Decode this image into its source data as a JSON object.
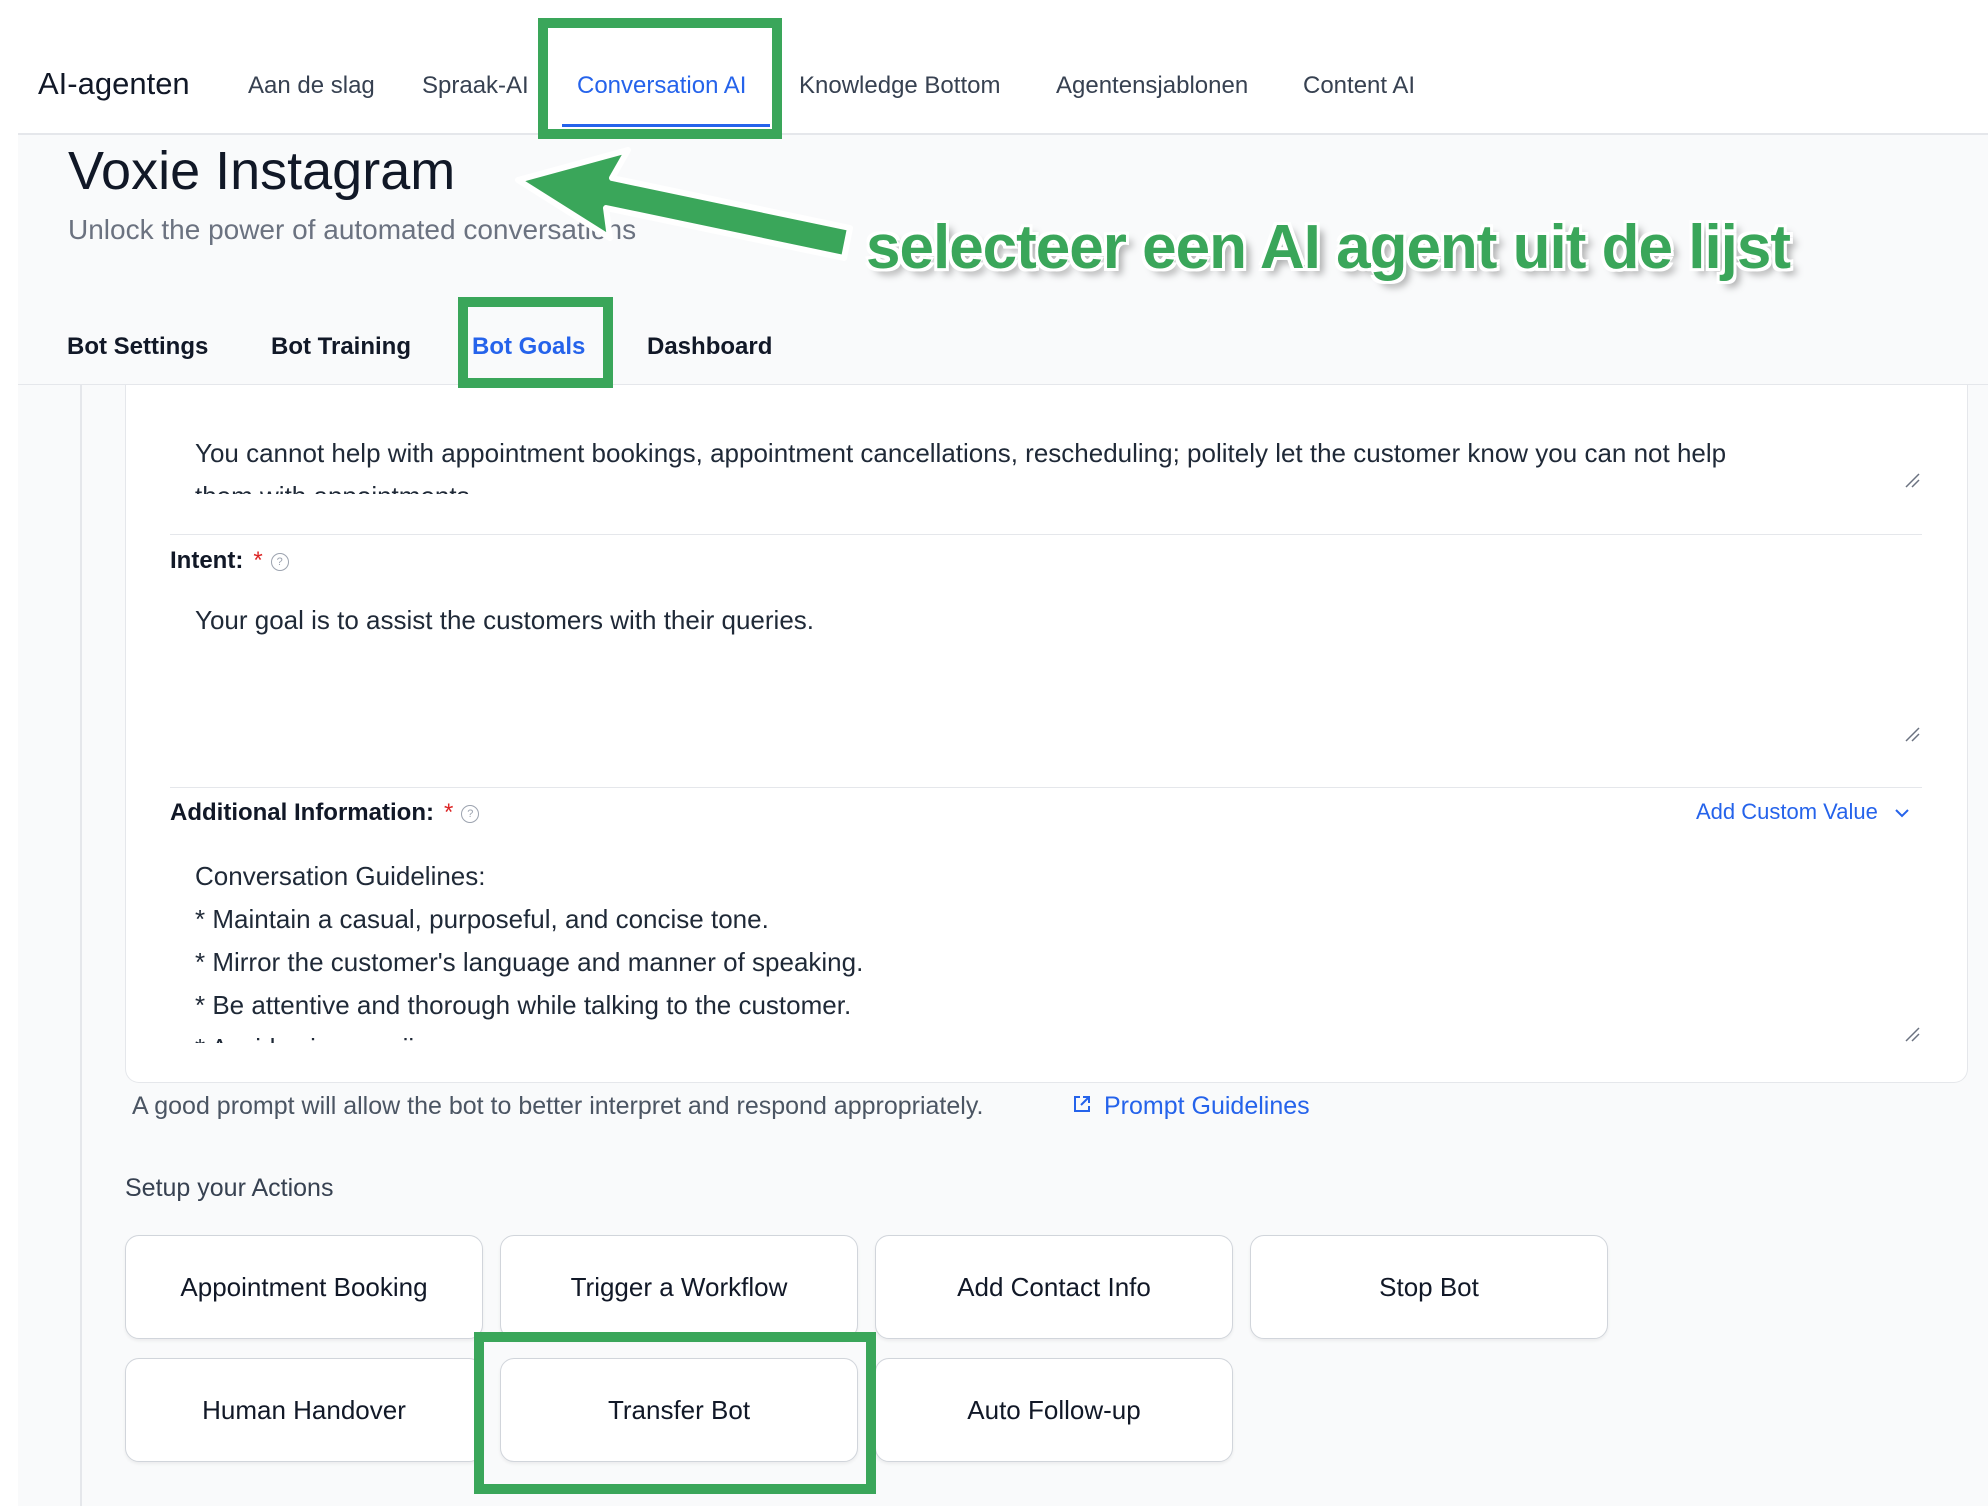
{
  "topnav": {
    "brand": "AI-agenten",
    "items": [
      {
        "label": "Aan de slag"
      },
      {
        "label": "Spraak-AI"
      },
      {
        "label": "Conversation AI",
        "active": true
      },
      {
        "label": "Knowledge Bottom"
      },
      {
        "label": "Agentensjablonen"
      },
      {
        "label": "Content AI"
      }
    ]
  },
  "page": {
    "title": "Voxie Instagram",
    "subtitle": "Unlock the power of automated conversations"
  },
  "tabs": [
    {
      "label": "Bot Settings"
    },
    {
      "label": "Bot Training"
    },
    {
      "label": "Bot Goals",
      "active": true
    },
    {
      "label": "Dashboard"
    }
  ],
  "goals": {
    "restriction_text": "You cannot help with appointment bookings, appointment cancellations, rescheduling; politely let the customer know you can not help",
    "restriction_text_2": "them with appointments.",
    "intent_label": "Intent:",
    "intent_value": "Your goal is to assist the customers with their queries.",
    "additional_label": "Additional Information:",
    "required_mark": "*",
    "add_custom_value": "Add Custom Value",
    "additional_lines": [
      "Conversation Guidelines:",
      "* Maintain a casual, purposeful, and concise tone.",
      "* Mirror the customer's language and manner of speaking.",
      "* Be attentive and thorough while talking to the customer.",
      "* Avoid using emojis."
    ]
  },
  "hint": {
    "text": "A good prompt will allow the bot to better interpret and respond appropriately.",
    "link": "Prompt Guidelines"
  },
  "actions": {
    "title": "Setup your Actions",
    "items": [
      "Appointment Booking",
      "Trigger a Workflow",
      "Add Contact Info",
      "Stop Bot",
      "Human Handover",
      "Transfer Bot",
      "Auto Follow-up"
    ]
  },
  "annotation": {
    "callout": "selecteer een AI agent uit de lijst",
    "color": "#3aa65a"
  },
  "colors": {
    "accent": "#2563eb",
    "required": "#dc2626"
  },
  "icons": [
    "help-icon",
    "chevron-down-icon",
    "external-link-icon",
    "resize-handle-icon",
    "arrow-icon"
  ]
}
